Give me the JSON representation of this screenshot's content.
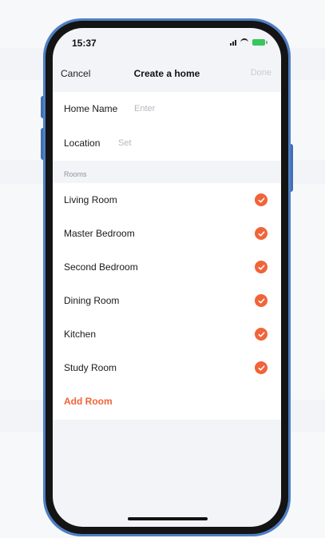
{
  "status": {
    "time": "15:37"
  },
  "nav": {
    "cancel_label": "Cancel",
    "title": "Create a home",
    "done_label": "Done"
  },
  "form": {
    "home_name_label": "Home Name",
    "home_name_placeholder": "Enter",
    "location_label": "Location",
    "location_value": "Set"
  },
  "rooms": {
    "section_title": "Rooms",
    "items": [
      {
        "label": "Living Room",
        "selected": true
      },
      {
        "label": "Master Bedroom",
        "selected": true
      },
      {
        "label": "Second Bedroom",
        "selected": true
      },
      {
        "label": "Dining Room",
        "selected": true
      },
      {
        "label": "Kitchen",
        "selected": true
      },
      {
        "label": "Study Room",
        "selected": true
      }
    ],
    "add_label": "Add Room"
  },
  "colors": {
    "accent": "#f0643a",
    "phone_frame": "#4f7fc4",
    "battery": "#35c759"
  },
  "icons": {
    "signal": "signal-icon",
    "wifi": "wifi-icon",
    "battery": "battery-icon",
    "check": "checkmark-circle-icon"
  }
}
